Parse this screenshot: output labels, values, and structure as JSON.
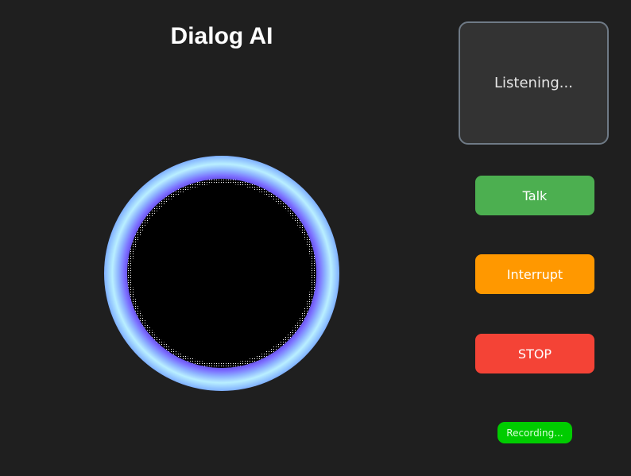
{
  "app": {
    "title": "Dialog AI"
  },
  "status": {
    "text": "Listening..."
  },
  "buttons": {
    "talk": {
      "label": "Talk",
      "color": "#4caf50"
    },
    "interrupt": {
      "label": "Interrupt",
      "color": "#ff9800"
    },
    "stop": {
      "label": "STOP",
      "color": "#f44336"
    }
  },
  "recording": {
    "label": "Recording...",
    "color": "#00cc00"
  },
  "orb": {
    "icon": "voice-orb",
    "ring_colors": [
      "#9ad8ff",
      "#b9efff",
      "#7b6dff",
      "#5a3fd8"
    ],
    "core_color": "#000000"
  }
}
